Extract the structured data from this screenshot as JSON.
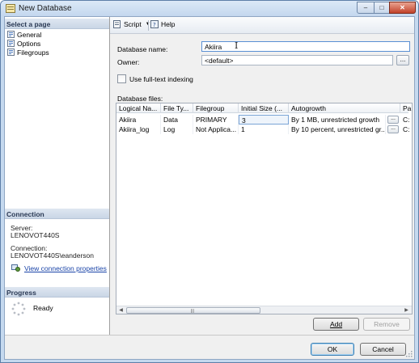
{
  "window": {
    "title": "New Database",
    "minimize_glyph": "–",
    "maximize_glyph": "□",
    "close_glyph": "✕"
  },
  "left": {
    "select_page_header": "Select a page",
    "pages": [
      {
        "label": "General",
        "icon": "general-page-icon"
      },
      {
        "label": "Options",
        "icon": "options-page-icon"
      },
      {
        "label": "Filegroups",
        "icon": "filegroups-page-icon"
      }
    ],
    "connection_header": "Connection",
    "server_label": "Server:",
    "server_value": "LENOVOT440S",
    "connection_label": "Connection:",
    "connection_value": "LENOVOT440S\\eanderson",
    "view_connection_link": "View connection properties",
    "progress_header": "Progress",
    "progress_status": "Ready"
  },
  "toolbar": {
    "script_label": "Script",
    "help_label": "Help"
  },
  "form": {
    "database_name_label": "Database name:",
    "database_name_value": "Akiira",
    "owner_label": "Owner:",
    "owner_value": "<default>",
    "ellipsis_label": "...",
    "fulltext_label": "Use full-text indexing",
    "fulltext_checked": false,
    "database_files_label": "Database files:"
  },
  "grid": {
    "columns": [
      "Logical Na...",
      "File Ty...",
      "Filegroup",
      "Initial Size (...",
      "Autogrowth",
      "Pa"
    ],
    "rows": [
      [
        "Akiira",
        "Data",
        "PRIMARY",
        "3",
        "By 1 MB, unrestricted growth",
        "C:"
      ],
      [
        "Akiira_log",
        "Log",
        "Not Applica...",
        "1",
        "By 10 percent, unrestricted gr...",
        "C:"
      ]
    ],
    "cell_button_label": "...",
    "scroll_left": "◀",
    "scroll_right": "▶",
    "scroll_grip": "|||"
  },
  "buttons": {
    "add": "Add",
    "remove": "Remove",
    "ok": "OK",
    "cancel": "Cancel"
  },
  "colors": {
    "accent": "#3c7fb1",
    "link": "#1a44a8"
  }
}
